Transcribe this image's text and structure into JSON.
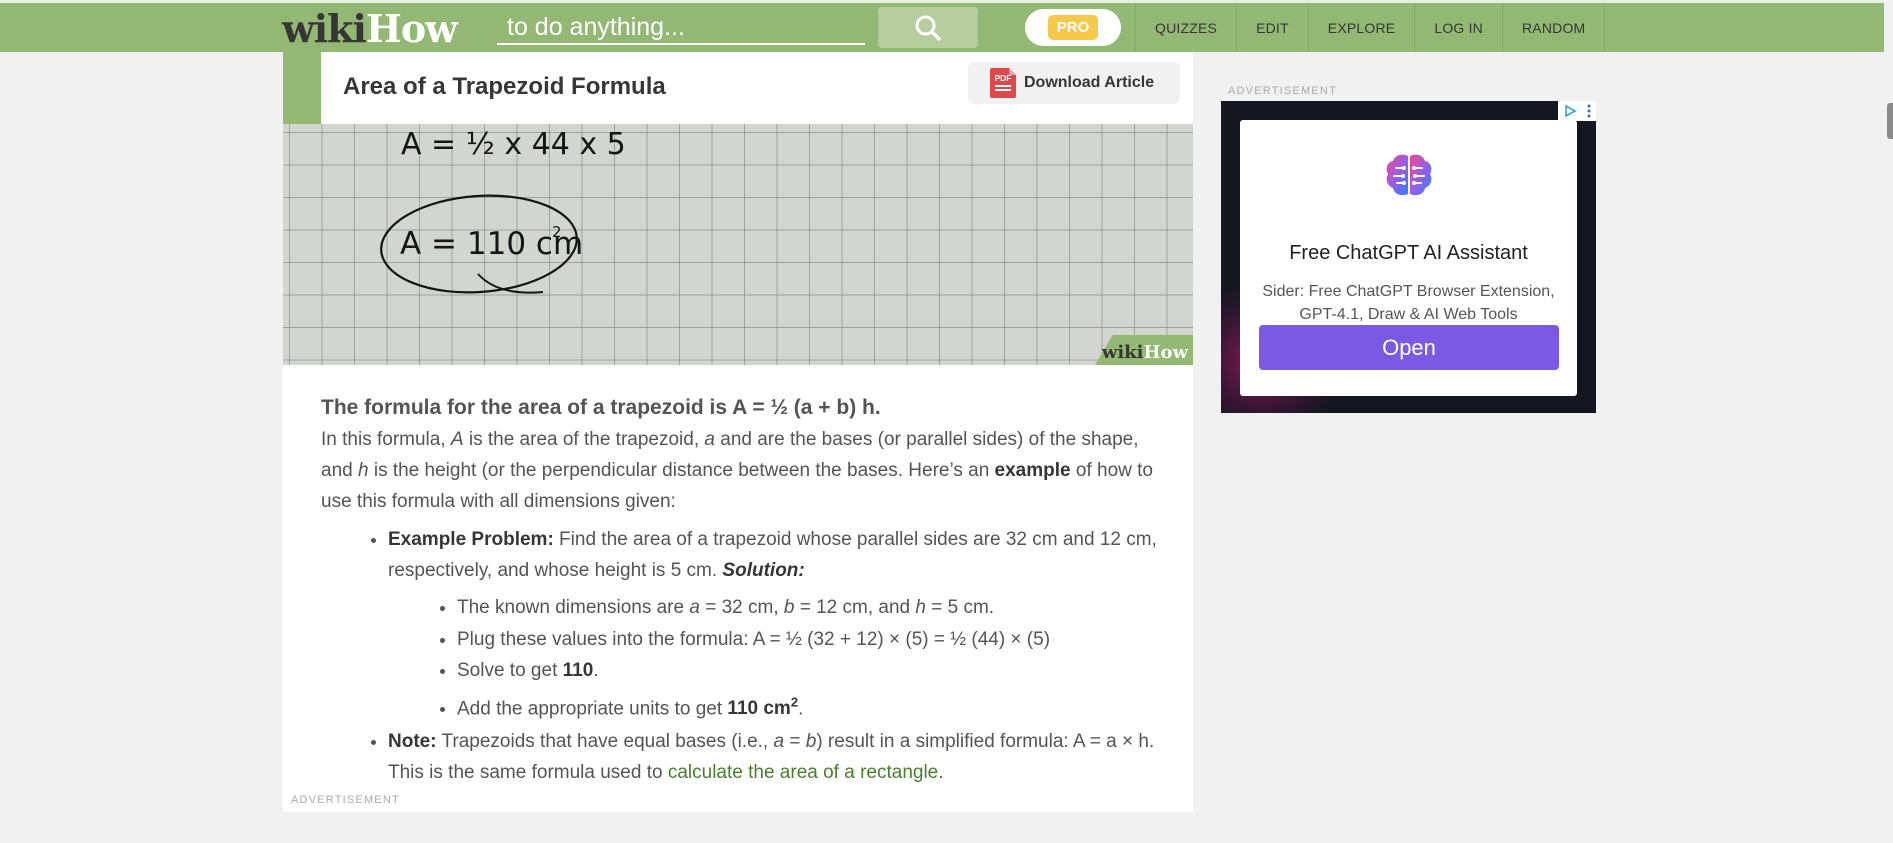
{
  "header": {
    "logo_wiki": "wiki",
    "logo_how": "How",
    "search_placeholder": "to do anything...",
    "pro_label": "PRO",
    "nav": [
      "QUIZZES",
      "EDIT",
      "EXPLORE",
      "LOG IN",
      "RANDOM"
    ],
    "colors": {
      "bar": "#93b874",
      "pro": "#f6c94a"
    }
  },
  "article": {
    "step_title": "Area of a Trapezoid Formula",
    "download_label": "Download Article",
    "download_icon_text": "PDF",
    "image": {
      "line1": "A = ½ x 44 x 5",
      "line2": "A = 110 cm",
      "line2_sup": "2",
      "watermark_wiki": "wiki",
      "watermark_how": "How"
    },
    "heading": "The formula for the area of a trapezoid is A = ½ (a + b) h.",
    "intro": {
      "t1": "In this formula, ",
      "A": "A",
      "t2": " is the area of the trapezoid, ",
      "a": "a",
      "t3": " and are the bases (or parallel sides) of the shape, and ",
      "h": "h",
      "t4": " is the height (or the perpendicular distance between the bases. Here’s an ",
      "example": "example",
      "t5": " of how to use this formula with all dimensions given:"
    },
    "example_problem": {
      "label": "Example Problem:",
      "text": " Find the area of a trapezoid whose parallel sides are 32 cm and 12 cm, respectively, and whose height is 5 cm. ",
      "solution": "Solution:"
    },
    "solution_steps": {
      "s1": {
        "t1": "The known dimensions are ",
        "a": "a",
        "t2": " = 32 cm, ",
        "b": "b",
        "t3": " = 12 cm, and ",
        "h": "h",
        "t4": " = 5 cm."
      },
      "s2": "Plug these values into the formula: A = ½ (32 + 12) × (5) = ½ (44) × (5)",
      "s3": {
        "t1": "Solve to get ",
        "bold": "110",
        "t2": "."
      },
      "s4": {
        "t1": "Add the appropriate units to get ",
        "bold": "110 cm",
        "sup": "2",
        "t2": "."
      }
    },
    "note": {
      "label": "Note:",
      "t1": " Trapezoids that have equal bases (i.e., ",
      "a": "a",
      "t2": " = ",
      "b": "b",
      "t3": ") result in a simplified formula: A = a × h. This is the same formula used to ",
      "link": "calculate the area of a rectangle",
      "t4": "."
    },
    "ad_label": "ADVERTISEMENT"
  },
  "sidebar_ad": {
    "label": "ADVERTISEMENT",
    "icon": "brain-icon",
    "title": "Free ChatGPT AI Assistant",
    "description": "Sider: Free ChatGPT Browser Extension, GPT-4.1, Draw & AI Web Tools",
    "button": "Open",
    "button_color": "#7b5ae3"
  }
}
